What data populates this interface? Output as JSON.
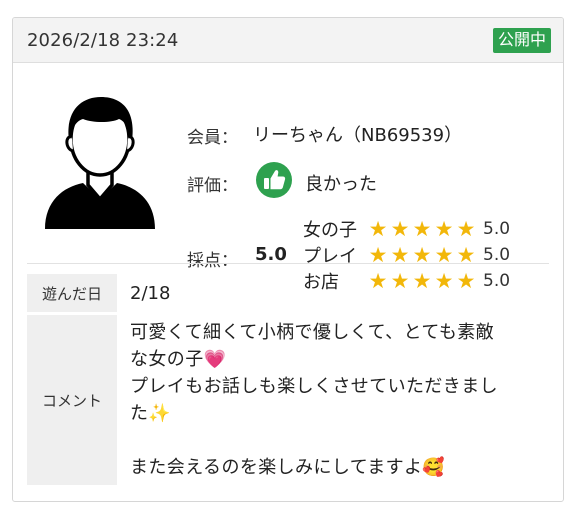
{
  "header": {
    "date": "2026/2/18 23:24",
    "status": "公開中",
    "status_color": "#2ea14f"
  },
  "profile": {
    "avatar_icon": "user-silhouette-icon",
    "member_label": "会員：",
    "member_value": "リーちゃん（NB69539）",
    "rating_label": "評価：",
    "rating_icon": "thumbs-up-icon",
    "rating_value": "良かった",
    "score_label": "採点：",
    "score_value": "5.0",
    "sub_ratings": [
      {
        "label": "女の子",
        "stars": 5,
        "score": "5.0"
      },
      {
        "label": "プレイ",
        "stars": 5,
        "score": "5.0"
      },
      {
        "label": "お店",
        "stars": 5,
        "score": "5.0"
      }
    ],
    "star_color": "#f2b70a"
  },
  "details": {
    "date_label": "遊んだ日",
    "date_value": "2/18",
    "comment_label": "コメント",
    "comment_lines": [
      "可愛くて細くて小柄で優しくて、とても素敵",
      "な女の子💗",
      "プレイもお話しも楽しくさせていただきまし",
      "た✨",
      "",
      "また会えるのを楽しみにしてますよ🥰"
    ]
  }
}
